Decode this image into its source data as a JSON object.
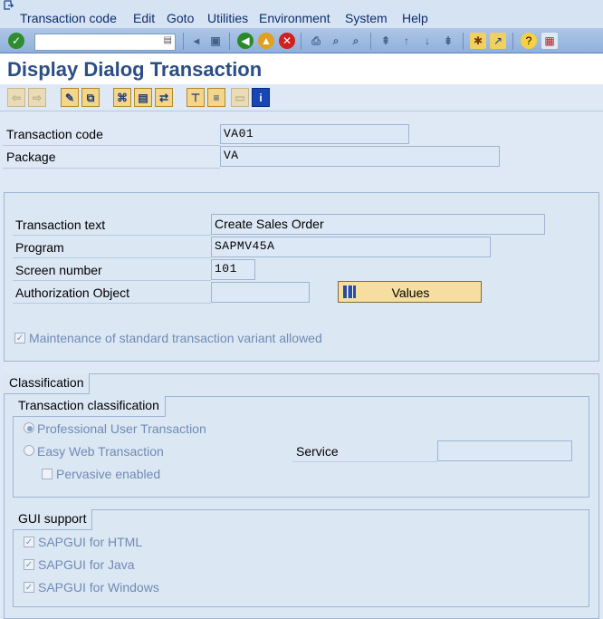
{
  "menu": [
    "Transaction code",
    "Edit",
    "Goto",
    "Utilities",
    "Environment",
    "System",
    "Help"
  ],
  "page_title": "Display Dialog Transaction",
  "header_fields": {
    "transaction_code_label": "Transaction code",
    "transaction_code_value": "VA01",
    "package_label": "Package",
    "package_value": "VA"
  },
  "details": {
    "transaction_text_label": "Transaction text",
    "transaction_text_value": "Create Sales Order",
    "program_label": "Program",
    "program_value": "SAPMV45A",
    "screen_number_label": "Screen number",
    "screen_number_value": "101",
    "auth_object_label": "Authorization Object",
    "auth_object_value": "",
    "values_button": "Values",
    "maintenance_checkbox": "Maintenance of standard transaction variant allowed"
  },
  "classification": {
    "tab": "Classification",
    "transaction_classification": {
      "title": "Transaction classification",
      "professional": "Professional User Transaction",
      "easy_web": "Easy Web Transaction",
      "service_label": "Service",
      "service_value": "",
      "pervasive": "Pervasive enabled"
    },
    "gui_support": {
      "title": "GUI support",
      "html": "SAPGUI for HTML",
      "java": "SAPGUI for Java",
      "windows": "SAPGUI for Windows"
    }
  },
  "colors": {
    "title": "#2b4e86",
    "button_yellow": "#f6dea0",
    "field_bg": "#dde8f6"
  }
}
